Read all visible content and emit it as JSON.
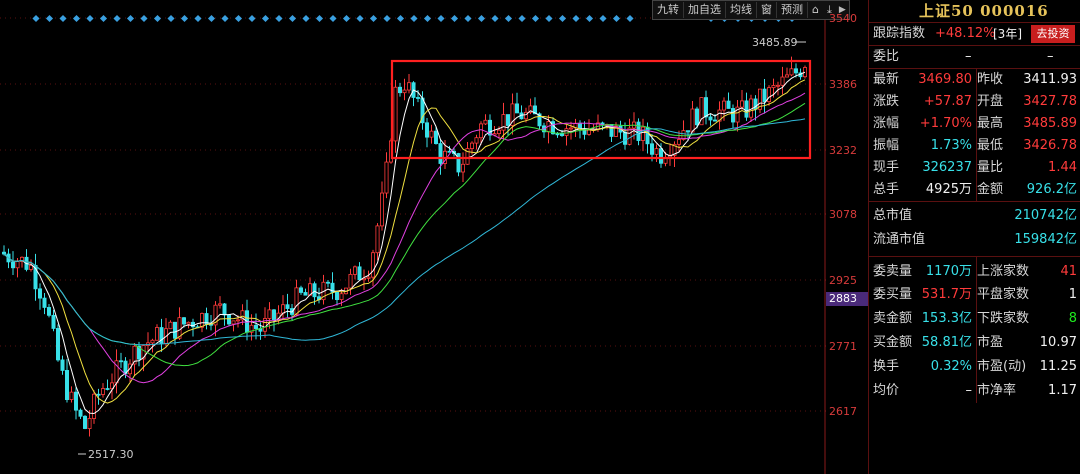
{
  "toolbar": {
    "items": [
      "九转",
      "加自选",
      "均线",
      "窗",
      "预测"
    ]
  },
  "price_axis": {
    "labels": [
      "3540",
      "3386",
      "3232",
      "3078",
      "2925",
      "2771",
      "2617"
    ],
    "current": "2883"
  },
  "chart_marks": {
    "high_label": "3485.89",
    "low_label": "2517.30"
  },
  "panel": {
    "title": "上证50 000016",
    "track_label": "跟踪指数",
    "track_value": "+48.12%",
    "track_period": "[3年]",
    "invest_button": "去投资",
    "weibi_label": "委比",
    "weibi_value": "–",
    "weibi_value2": "–",
    "latest_label": "最新",
    "latest_value": "3469.80",
    "prev_close_label": "昨收",
    "prev_close_value": "3411.93",
    "change_label": "涨跌",
    "change_value": "+57.87",
    "open_label": "开盘",
    "open_value": "3427.78",
    "pct_label": "涨幅",
    "pct_value": "+1.70%",
    "high_label": "最高",
    "high_value": "3485.89",
    "amp_label": "振幅",
    "amp_value": "1.73%",
    "low_label": "最低",
    "low_value": "3426.78",
    "cur_hand_label": "现手",
    "cur_hand_value": "326237",
    "vol_ratio_label": "量比",
    "vol_ratio_value": "1.44",
    "total_hand_label": "总手",
    "total_hand_value": "4925万",
    "amount_label": "金额",
    "amount_value": "926.2亿",
    "mkt_cap_label": "总市值",
    "mkt_cap_value": "210742亿",
    "float_cap_label": "流通市值",
    "float_cap_value": "159842亿",
    "sell_vol_label": "委卖量",
    "sell_vol_value": "1170万",
    "up_count_label": "上涨家数",
    "up_count_value": "41",
    "buy_vol_label": "委买量",
    "buy_vol_value": "531.7万",
    "flat_count_label": "平盘家数",
    "flat_count_value": "1",
    "sell_amt_label": "卖金额",
    "sell_amt_value": "153.3亿",
    "down_count_label": "下跌家数",
    "down_count_value": "8",
    "buy_amt_label": "买金额",
    "buy_amt_value": "58.81亿",
    "pe_label": "市盈",
    "pe_value": "10.97",
    "turnover_label": "换手",
    "turnover_value": "0.32%",
    "pe_dyn_label": "市盈(动)",
    "pe_dyn_value": "11.25",
    "avg_label": "均价",
    "avg_value": "–",
    "pb_label": "市净率",
    "pb_value": "1.17"
  },
  "colors": {
    "up": "#ff3b3b",
    "down": "#38e0e8",
    "box": "#ff2020",
    "ma5": "#ffffff",
    "ma10": "#f0e040",
    "ma20": "#e040e0",
    "ma30": "#40e040",
    "ma60": "#30b8d8"
  }
}
